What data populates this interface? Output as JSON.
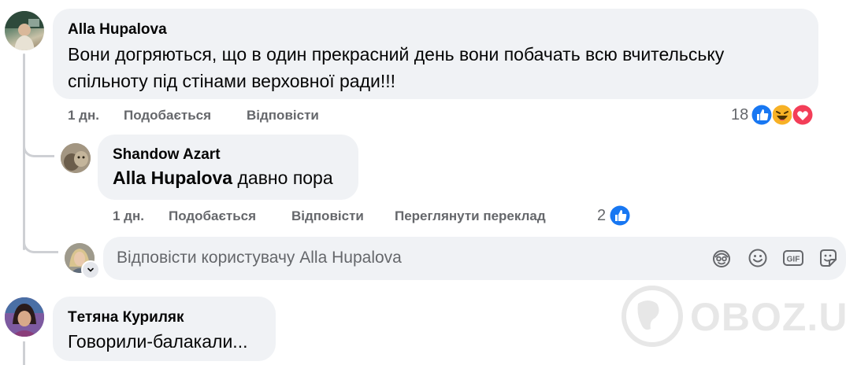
{
  "comments": [
    {
      "author": "Alla Hupalova",
      "text_line1": "Вони догряються, що в один прекрасний день вони побачать всю вчительську",
      "text_line2": "спільноту під стінами верховної ради!!!",
      "time": "1 дн.",
      "like_label": "Подобається",
      "reply_label": "Відповісти",
      "reactions_count": "18",
      "reactions": [
        "like-icon",
        "haha-icon",
        "love-icon"
      ]
    },
    {
      "author": "Tетяна Куриляк",
      "text": "Говорили-балакали..."
    }
  ],
  "reply": {
    "author": "Shandow Azart",
    "mention": "Alla Hupalova",
    "text": " давно пора",
    "time": "1 дн.",
    "like_label": "Подобається",
    "reply_label": "Відповісти",
    "translate_label": "Переглянути переклад",
    "reactions_count": "2"
  },
  "reply_box": {
    "placeholder": "Відповісти користувачу Alla Hupalova",
    "icons": [
      "avatar-sticker-icon",
      "emoji-icon",
      "gif-icon",
      "sticker-icon"
    ]
  },
  "watermark": "OBOZ.UA",
  "colors": {
    "like_blue": "#1877f2",
    "love_red": "#f33e58",
    "haha_yellow": "#f7b125",
    "bubble": "#f0f2f5",
    "muted": "#65676b"
  }
}
